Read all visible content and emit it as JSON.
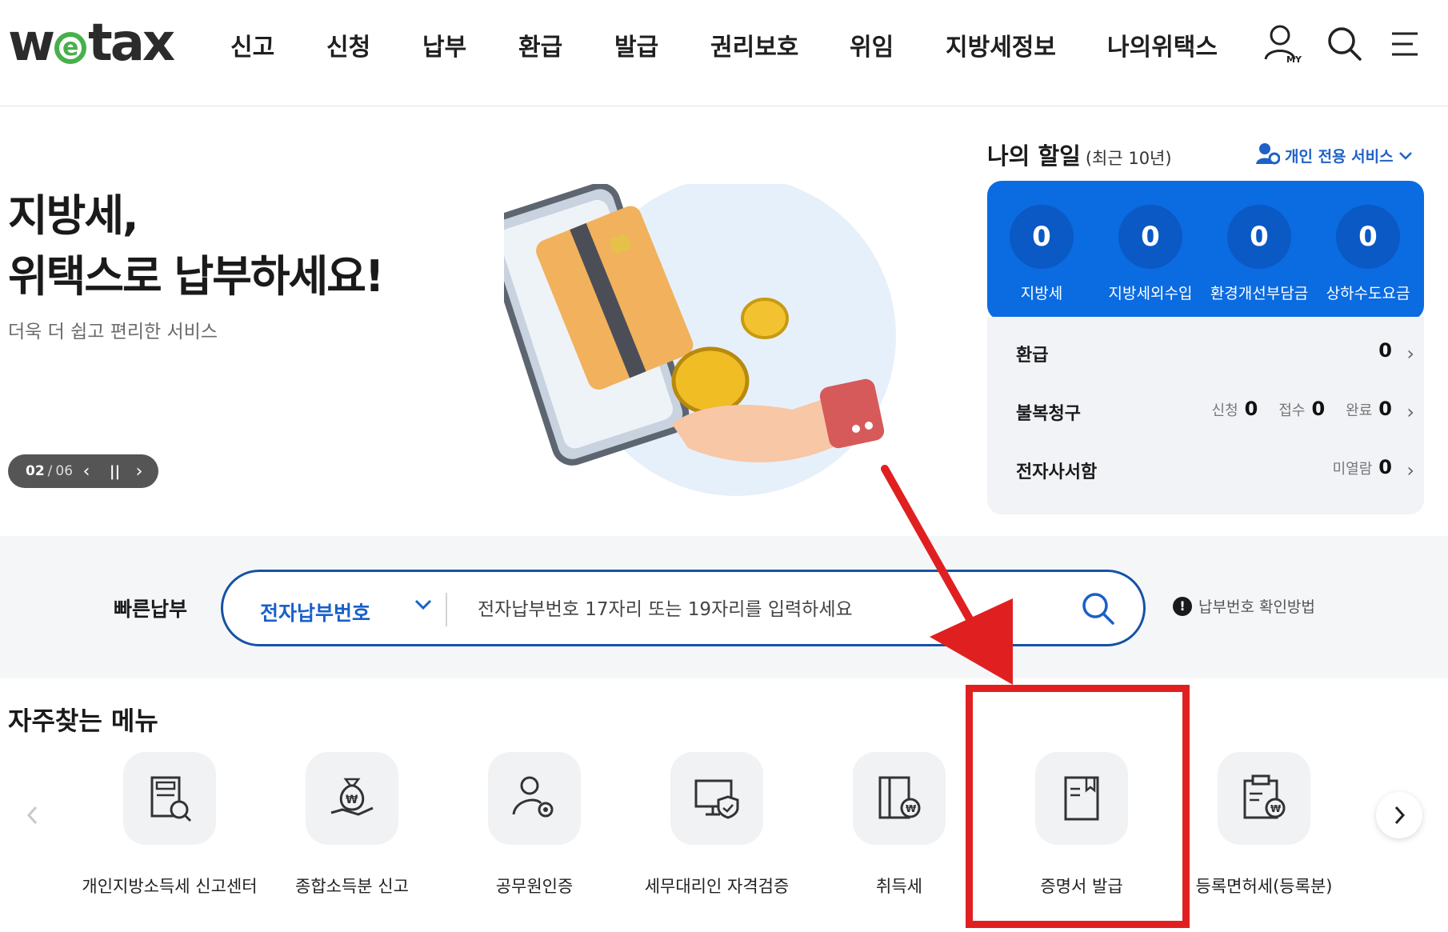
{
  "header": {
    "logo": {
      "w": "w",
      "e": "e",
      "tax": "tax"
    },
    "nav": [
      "신고",
      "신청",
      "납부",
      "환급",
      "발급",
      "권리보호",
      "위임",
      "지방세정보",
      "나의위택스"
    ],
    "icons": [
      "my-page-icon",
      "search-icon",
      "menu-icon"
    ],
    "my_badge": "MY"
  },
  "hero": {
    "title_line1": "지방세,",
    "title_line2": "위택스로 납부하세요!",
    "subtitle": "더욱 더 쉽고 편리한 서비스",
    "pager": {
      "current": "02",
      "total": "06",
      "separator": "/"
    }
  },
  "tasks": {
    "title": "나의 할일",
    "period": "(최근 10년)",
    "service_toggle": "개인 전용 서비스",
    "counts": [
      {
        "label": "지방세",
        "value": "0"
      },
      {
        "label": "지방세외수입",
        "value": "0"
      },
      {
        "label": "환경개선부담금",
        "value": "0"
      },
      {
        "label": "상하수도요금",
        "value": "0"
      }
    ],
    "rows": {
      "refund": {
        "title": "환급",
        "value": "0"
      },
      "appeal": {
        "title": "불복청구",
        "applied_label": "신청",
        "applied": "0",
        "received_label": "접수",
        "received": "0",
        "done_label": "완료",
        "done": "0"
      },
      "mailbox": {
        "title": "전자사서함",
        "unread_label": "미열람",
        "unread": "0"
      }
    }
  },
  "quick_pay": {
    "label": "빠른납부",
    "select_value": "전자납부번호",
    "placeholder": "전자납부번호 17자리 또는 19자리를 입력하세요",
    "help": "납부번호 확인방법",
    "help_mark": "!"
  },
  "frequent_menu": {
    "title": "자주찾는 메뉴",
    "items": [
      {
        "label": "개인지방소득세 신고센터",
        "icon": "building-search-icon"
      },
      {
        "label": "종합소득분 신고",
        "icon": "money-bag-hand-icon"
      },
      {
        "label": "공무원인증",
        "icon": "person-gear-icon"
      },
      {
        "label": "세무대리인 자격검증",
        "icon": "monitor-shield-icon"
      },
      {
        "label": "취득세",
        "icon": "building-won-icon"
      },
      {
        "label": "증명서 발급",
        "icon": "document-bookmark-icon"
      },
      {
        "label": "등록면허세(등록분)",
        "icon": "clipboard-won-icon"
      }
    ]
  },
  "colors": {
    "brand_blue": "#0b6be0",
    "link_blue": "#1960c8",
    "logo_green": "#47b04b",
    "annotation_red": "#e02020"
  }
}
